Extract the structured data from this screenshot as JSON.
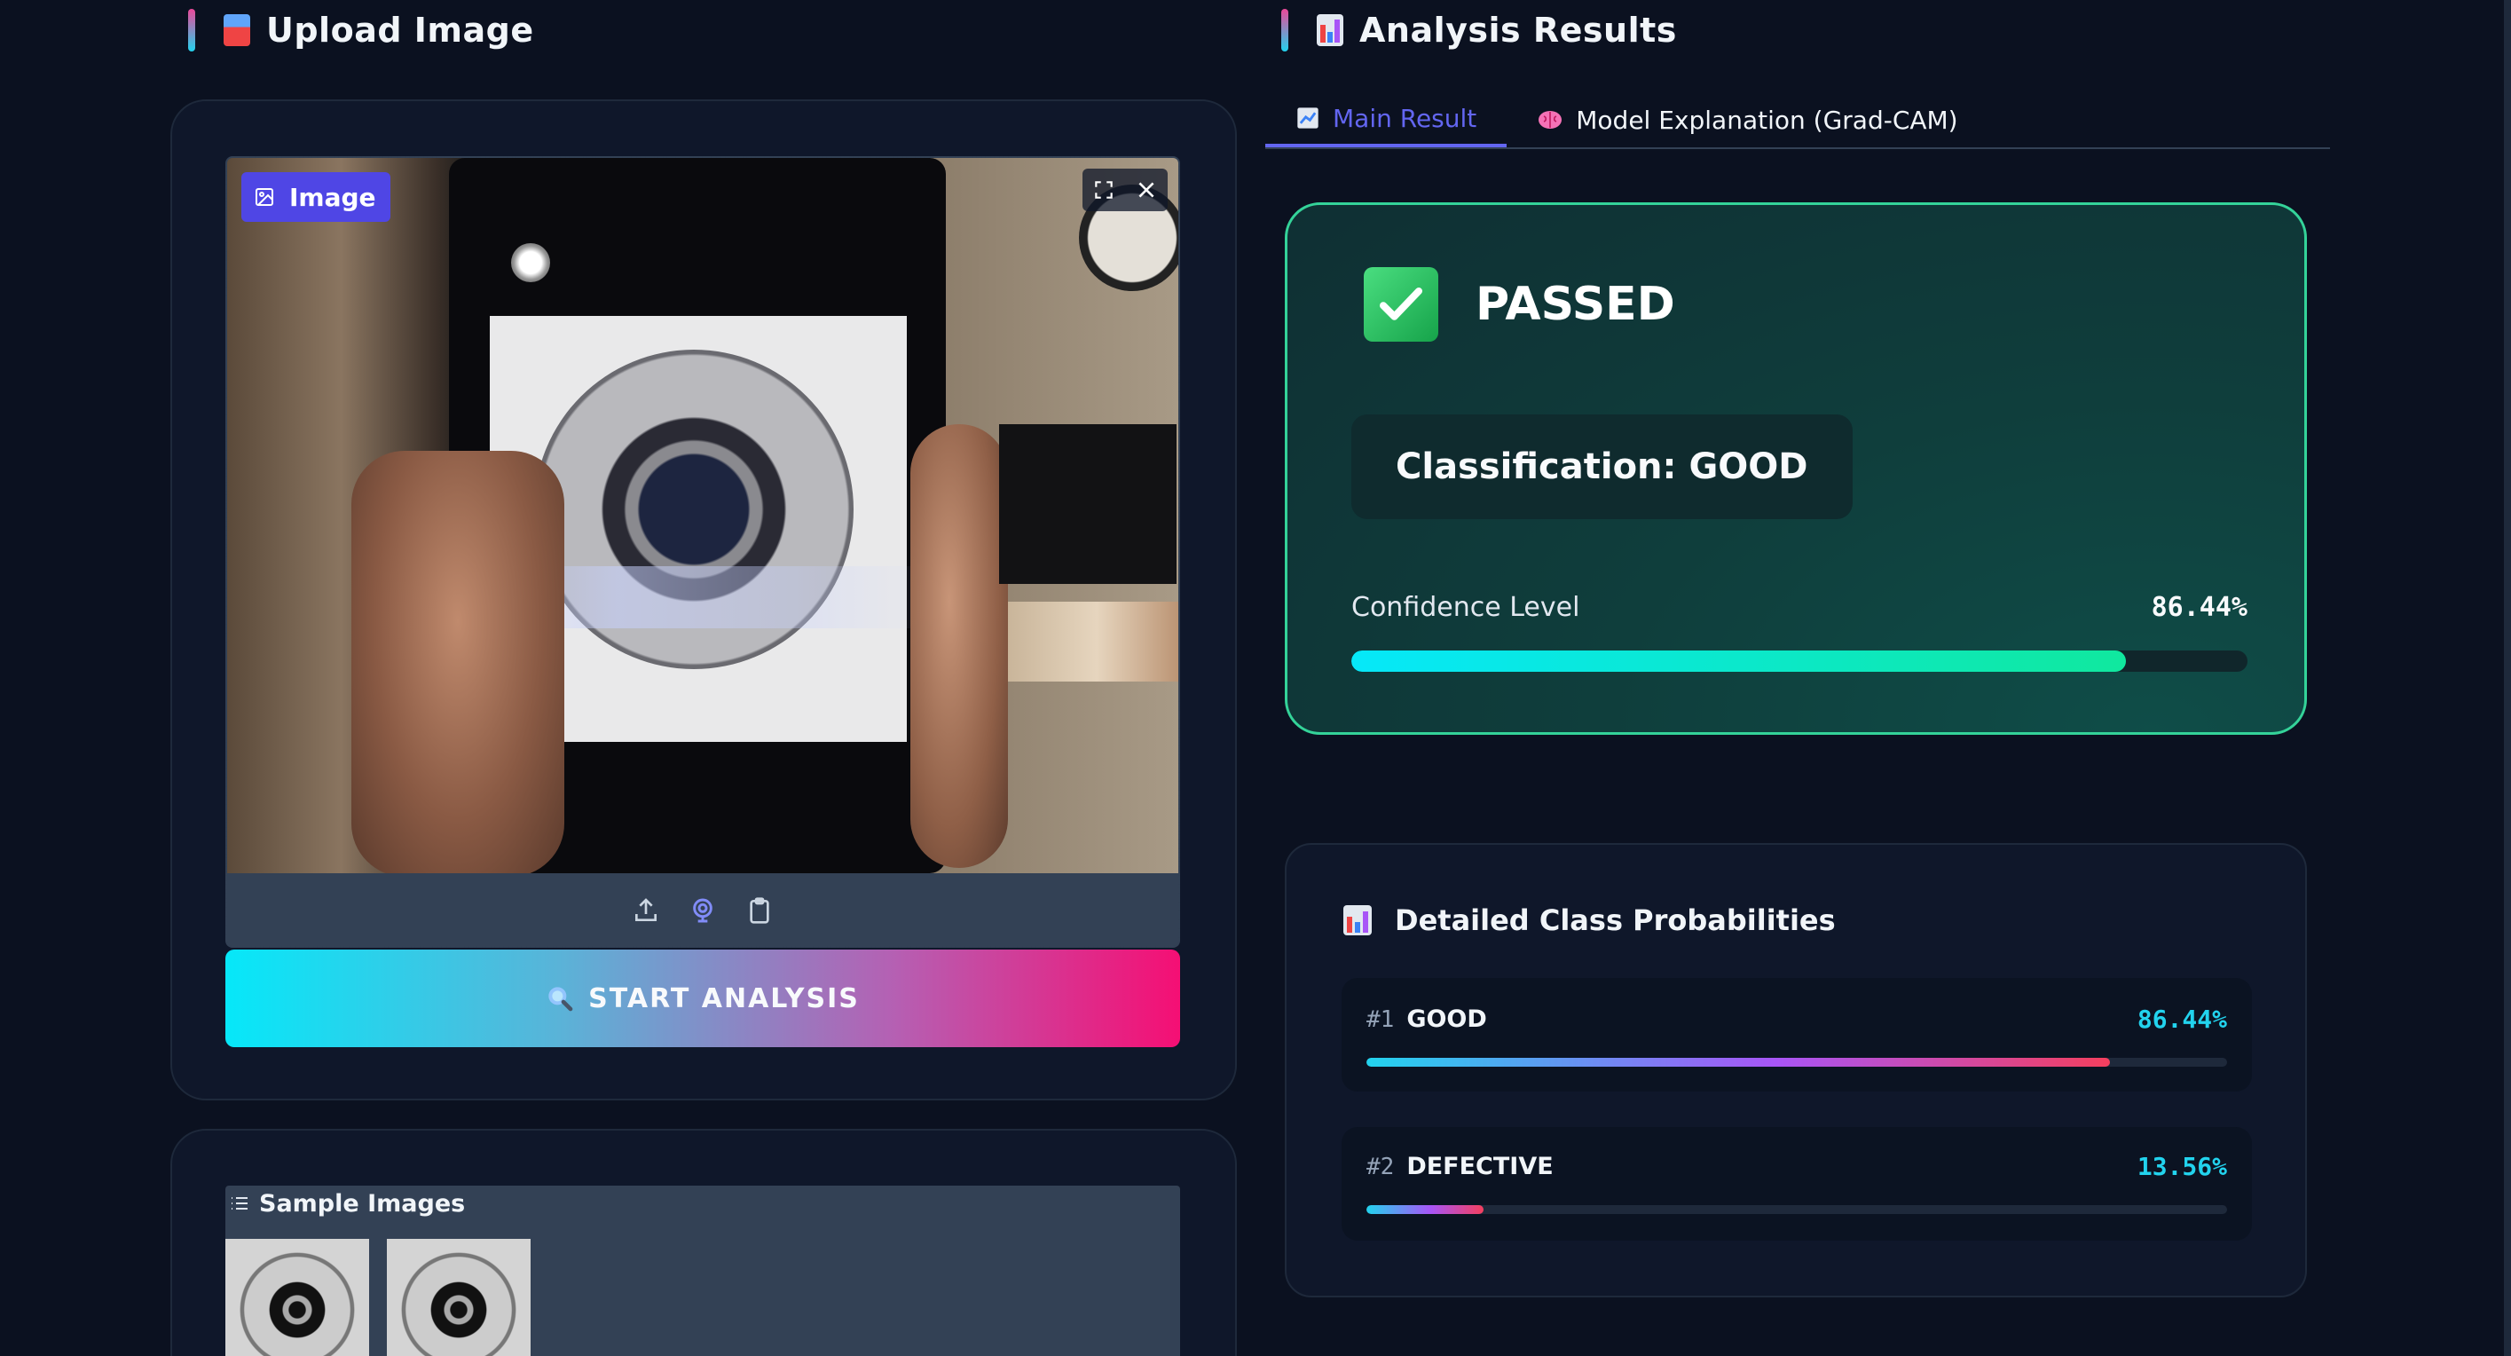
{
  "upload": {
    "title": "Upload Image",
    "image_label": "Image",
    "start_button": "START ANALYSIS",
    "toolbar_icons": [
      "upload-icon",
      "webcam-icon",
      "clipboard-icon"
    ],
    "samples_title": "Sample Images",
    "sample_count": 2
  },
  "results": {
    "title": "Analysis Results",
    "tabs": [
      {
        "label": "Main Result",
        "active": true,
        "icon": "chart-icon"
      },
      {
        "label": "Model Explanation (Grad-CAM)",
        "active": false,
        "icon": "brain-icon"
      }
    ],
    "verdict": "PASSED",
    "classification": "Classification: GOOD",
    "confidence_label": "Confidence Level",
    "confidence_value": "86.44%",
    "confidence_fraction": 0.8644,
    "probabilities_title": "Detailed Class Probabilities",
    "classes": [
      {
        "rank": "#1",
        "name": "GOOD",
        "value": "86.44%",
        "fraction": 0.8644
      },
      {
        "rank": "#2",
        "name": "DEFECTIVE",
        "value": "13.56%",
        "fraction": 0.1356
      }
    ]
  },
  "colors": {
    "background": "#0b1120",
    "accent_indigo": "#6366f1",
    "pass_green": "#34d399",
    "cyan": "#22d3ee",
    "pink": "#f50f74"
  }
}
